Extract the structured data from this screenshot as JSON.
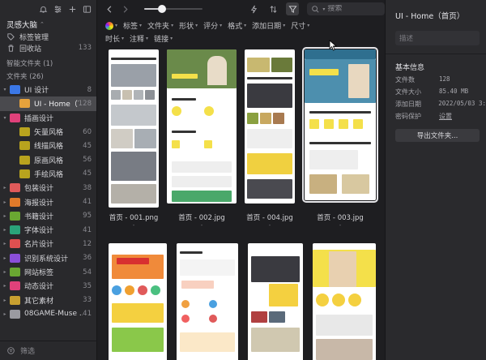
{
  "sidebar": {
    "library_name": "灵感大脑",
    "nav": [
      {
        "label": "标签管理",
        "count": ""
      },
      {
        "label": "回收站",
        "count": "133"
      }
    ],
    "smart_folders_title": "智能文件夹 (1)",
    "folders_title": "文件夹 (26)",
    "folders": [
      {
        "label": "UI 设计",
        "count": "8",
        "level": 0,
        "expanded": true,
        "color": "#3b78e7"
      },
      {
        "label": "UI - Home（首页）",
        "count": "128",
        "level": 1,
        "active": true,
        "color": "#e6a23c"
      },
      {
        "label": "插画设计",
        "count": "",
        "level": 0,
        "expanded": true,
        "color": "#e0417a"
      },
      {
        "label": "矢量风格",
        "count": "60",
        "level": 1,
        "color": "#b8a31e"
      },
      {
        "label": "线描风格",
        "count": "45",
        "level": 1,
        "color": "#b8a31e"
      },
      {
        "label": "原画风格",
        "count": "56",
        "level": 1,
        "color": "#b8a31e"
      },
      {
        "label": "手绘风格",
        "count": "45",
        "level": 1,
        "color": "#b8a31e"
      },
      {
        "label": "包装设计",
        "count": "38",
        "level": 0,
        "color": "#e05a5a"
      },
      {
        "label": "海报设计",
        "count": "41",
        "level": 0,
        "color": "#e07a2a"
      },
      {
        "label": "书籍设计",
        "count": "95",
        "level": 0,
        "color": "#6aa832"
      },
      {
        "label": "字体设计",
        "count": "41",
        "level": 0,
        "color": "#2aa37a"
      },
      {
        "label": "名片设计",
        "count": "12",
        "level": 0,
        "color": "#e05050"
      },
      {
        "label": "识别系统设计",
        "count": "36",
        "level": 0,
        "color": "#8a4fd8"
      },
      {
        "label": "网站标签",
        "count": "54",
        "level": 0,
        "color": "#6aa832"
      },
      {
        "label": "动态设计",
        "count": "35",
        "level": 0,
        "color": "#e0417a"
      },
      {
        "label": "其它素材",
        "count": "33",
        "level": 0,
        "color": "#c8a030"
      },
      {
        "label": "08GAME-Muse ...",
        "count": "41",
        "level": 0,
        "color": "#9a9aa0"
      }
    ],
    "filter_placeholder": "筛选"
  },
  "toolbar": {
    "zoom_value": 0.3,
    "search_placeholder": "搜索"
  },
  "filters": [
    "标签",
    "文件夹",
    "形状",
    "评分",
    "格式",
    "添加日期",
    "尺寸",
    "时长",
    "注释",
    "链接"
  ],
  "thumbnails": [
    {
      "caption": "首页 - 001.png",
      "sub": "-"
    },
    {
      "caption": "首页 - 002.jpg",
      "sub": "-"
    },
    {
      "caption": "首页 - 004.jpg",
      "sub": "-"
    },
    {
      "caption": "首页 - 003.jpg",
      "sub": "-"
    },
    {
      "caption": "",
      "sub": ""
    },
    {
      "caption": "",
      "sub": ""
    },
    {
      "caption": "",
      "sub": ""
    },
    {
      "caption": "",
      "sub": ""
    }
  ],
  "inspector": {
    "title": "UI - Home（首页）",
    "desc_placeholder": "描述",
    "section": "基本信息",
    "rows": [
      {
        "key": "文件数",
        "value": "128"
      },
      {
        "key": "文件大小",
        "value": "85.40 MB"
      },
      {
        "key": "添加日期",
        "value": "2022/05/03 3:"
      },
      {
        "key": "密码保护",
        "value": "设置"
      }
    ],
    "export_label": "导出文件夹..."
  }
}
